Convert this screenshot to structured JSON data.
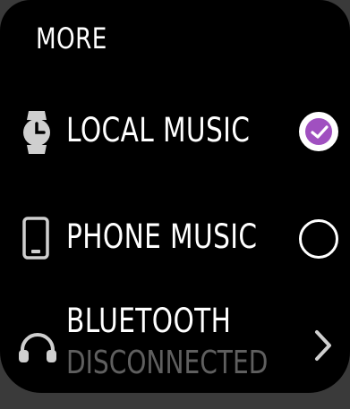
{
  "header": {
    "title": "MORE"
  },
  "items": [
    {
      "label": "LOCAL MUSIC",
      "icon": "watch-icon",
      "control": "radio",
      "selected": true
    },
    {
      "label": "PHONE MUSIC",
      "icon": "phone-icon",
      "control": "radio",
      "selected": false
    },
    {
      "label": "BLUETOOTH",
      "sublabel": "DISCONNECTED",
      "icon": "headphones-icon",
      "control": "chevron"
    }
  ],
  "colors": {
    "background": "#000000",
    "text": "#ffffff",
    "subtext": "#5f5f5f",
    "accent": "#a050c0",
    "icon": "#cfcfcf"
  }
}
